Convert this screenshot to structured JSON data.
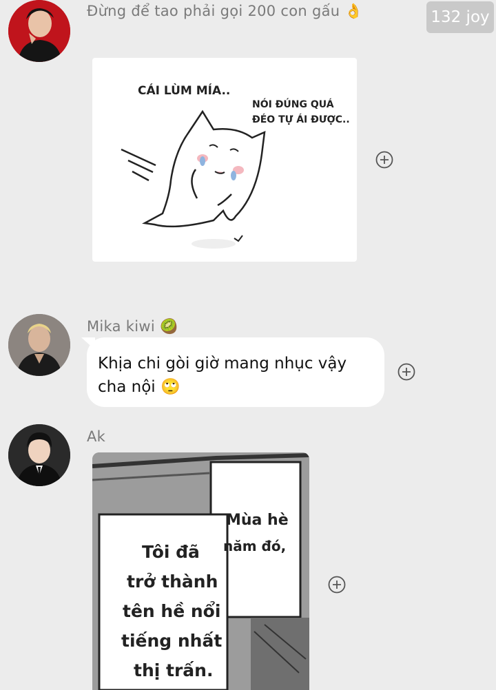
{
  "badge": {
    "text": "132 joy"
  },
  "messages": [
    {
      "sender": "Đừng để tao phải gọi 200 con gấu 👌",
      "kind": "sticker",
      "sticker": {
        "line1": "CÁI LÙM MÍA..",
        "line2": "NÓI ĐÚNG QUÁ",
        "line3": "ĐÉO TỰ ÁI ĐƯỢC.."
      }
    },
    {
      "sender": "Mika kiwi 🥝",
      "kind": "text",
      "text_line1": "Khịa chi gòi giờ mang nhục vậy",
      "text_line2": "cha nội 🙄"
    },
    {
      "sender": "Ak",
      "kind": "image",
      "manga": {
        "box1_line1": "Mùa hè",
        "box1_line2": "năm đó,",
        "box2_line1": "Tôi đã",
        "box2_line2": "trở thành",
        "box2_line3": "tên hề nổi",
        "box2_line4": "tiếng nhất",
        "box2_line5": "thị trấn."
      }
    }
  ],
  "icons": {
    "add": "plus-circle-icon"
  },
  "colors": {
    "background": "#ececec",
    "bubble": "#ffffff",
    "badge": "#c9c9c9",
    "sender": "#7a7a7a"
  }
}
